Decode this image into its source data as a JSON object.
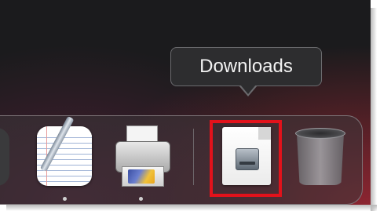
{
  "tooltip": {
    "text": "Downloads"
  },
  "dock": {
    "items": [
      {
        "icon": "app-icon",
        "running": false
      },
      {
        "icon": "textedit-icon",
        "running": true
      },
      {
        "icon": "printer-icon",
        "running": true
      },
      {
        "icon": "downloads-stack-icon",
        "running": false
      },
      {
        "icon": "trash-icon",
        "running": false
      }
    ]
  },
  "highlight_color": "#e2121b"
}
